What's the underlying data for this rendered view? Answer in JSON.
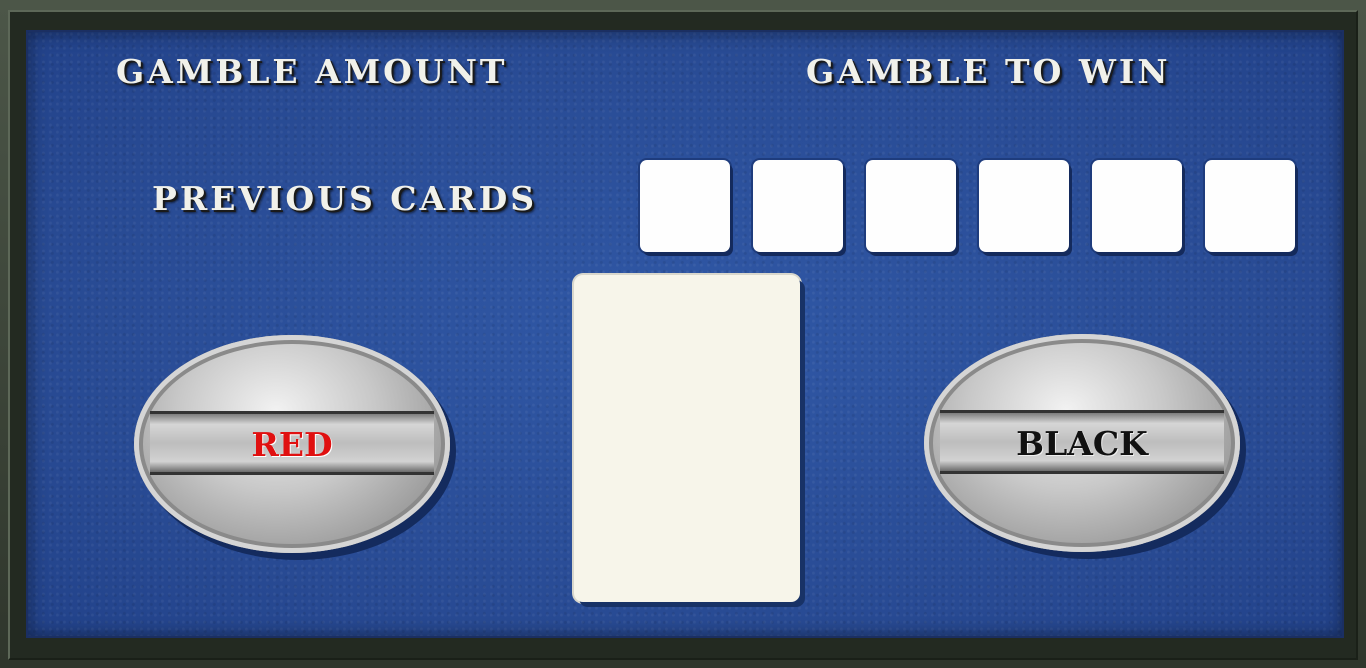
{
  "labels": {
    "gamble_amount": "GAMBLE AMOUNT",
    "gamble_to_win": "GAMBLE TO WIN",
    "previous_cards": "PREVIOUS CARDS"
  },
  "buttons": {
    "red": "RED",
    "black": "BLACK"
  },
  "previous_cards": [
    "",
    "",
    "",
    "",
    "",
    ""
  ],
  "colors": {
    "table": "#2b4f9a",
    "frame": "#3a4237",
    "red_button_text": "#e01010",
    "black_button_text": "#111111",
    "card": "#f7f5ea"
  }
}
